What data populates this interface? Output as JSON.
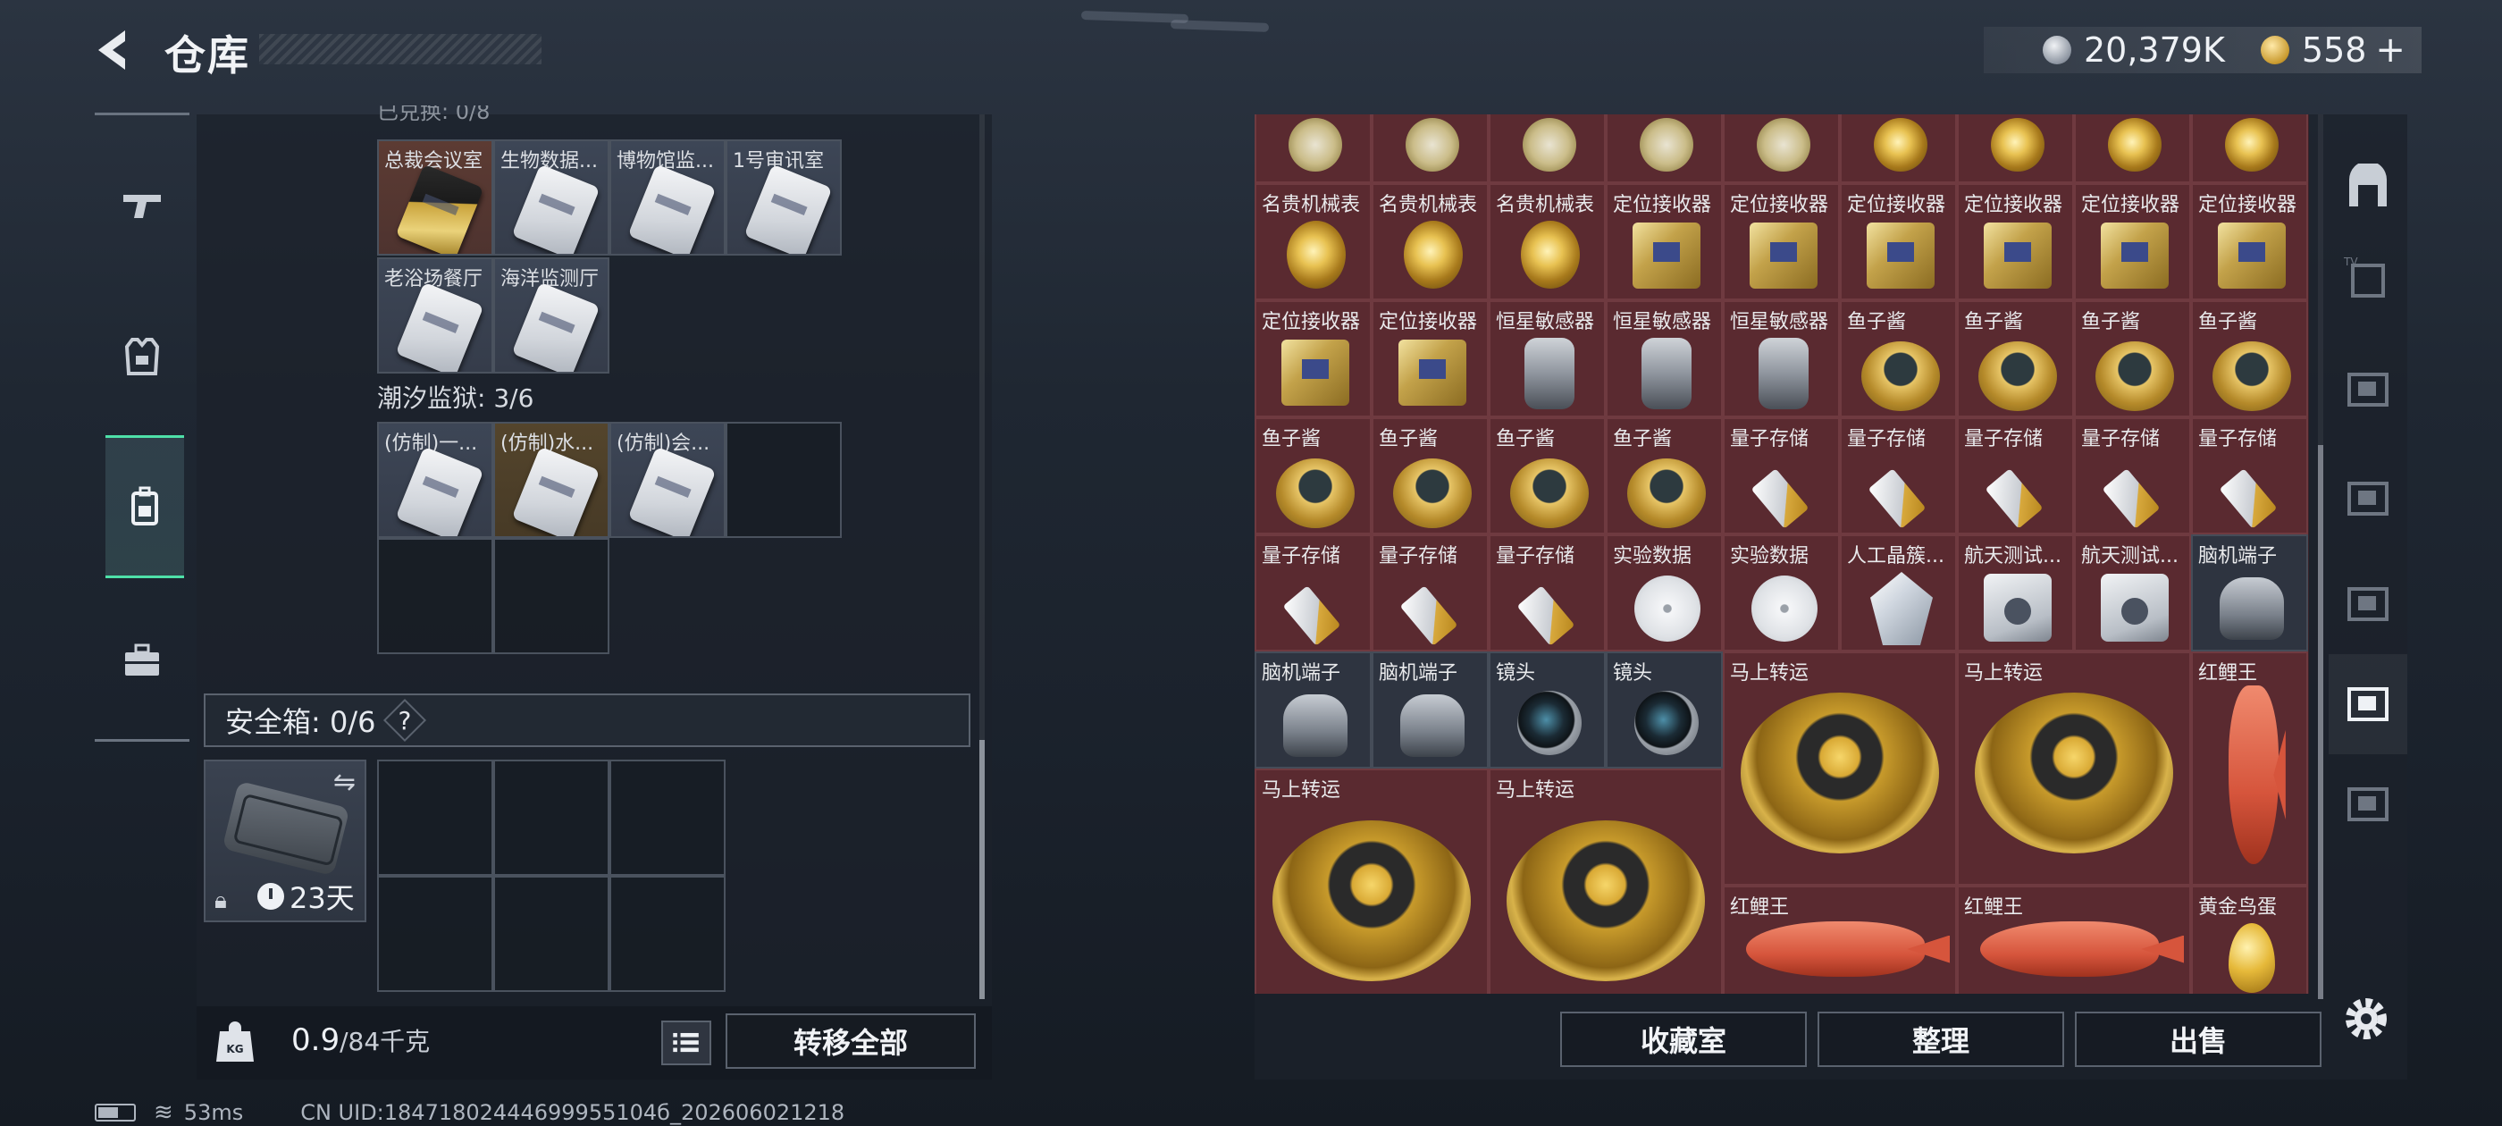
{
  "header": {
    "title": "仓库"
  },
  "currency": {
    "silver_value": "20,379K",
    "gold_value": "558",
    "plus": "+"
  },
  "left_tabs": [
    "weapons-tab",
    "armor-tab",
    "backpack-tab",
    "toolbox-tab"
  ],
  "keycards": {
    "top_section_label": "已兑换: 0/8",
    "row1": [
      "总裁会议室",
      "生物数据...",
      "博物馆监...",
      "1号审讯室"
    ],
    "row2": [
      "老浴场餐厅",
      "海洋监测厅"
    ],
    "prison_label": "潮汐监狱: 3/6",
    "prison_cards": [
      "(仿制)一...",
      "(仿制)水...",
      "(仿制)会..."
    ]
  },
  "secure_box": {
    "label": "安全箱: 0/6",
    "help": "?",
    "timer": "23天"
  },
  "weight": {
    "current": "0.9",
    "max": "/84千克"
  },
  "buttons": {
    "transfer_all": "转移全部",
    "collection": "收藏室",
    "sort": "整理",
    "sell": "出售"
  },
  "items": {
    "watch": "名贵机械表",
    "receiver": "定位接收器",
    "sensor": "恒星敏感器",
    "caviar": "鱼子酱",
    "quantum": "量子存储",
    "data": "实验数据",
    "gem": "人工晶簇...",
    "aero": "航天测试...",
    "bci": "脑机端子",
    "lens": "镜头",
    "horse": "马上转运",
    "carp": "红鲤王",
    "egg": "黄金鸟蛋"
  },
  "status": {
    "ping": "53ms",
    "uid": "CN UID:18471802444699955104б_202606021218"
  },
  "colors": {
    "rare_red": "#5a2a30",
    "accent_green": "#4ee0a8"
  }
}
